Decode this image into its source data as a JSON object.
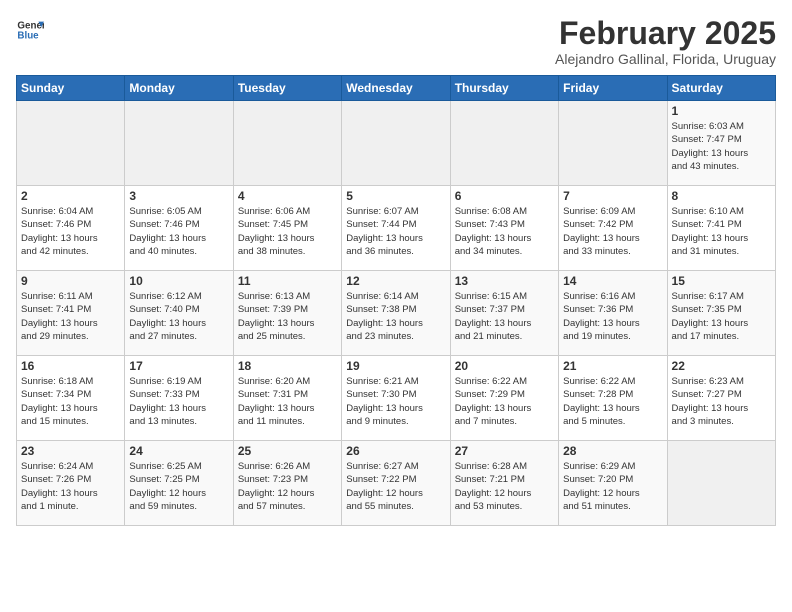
{
  "header": {
    "logo_general": "General",
    "logo_blue": "Blue",
    "title": "February 2025",
    "subtitle": "Alejandro Gallinal, Florida, Uruguay"
  },
  "days_of_week": [
    "Sunday",
    "Monday",
    "Tuesday",
    "Wednesday",
    "Thursday",
    "Friday",
    "Saturday"
  ],
  "weeks": [
    [
      {
        "day": "",
        "info": ""
      },
      {
        "day": "",
        "info": ""
      },
      {
        "day": "",
        "info": ""
      },
      {
        "day": "",
        "info": ""
      },
      {
        "day": "",
        "info": ""
      },
      {
        "day": "",
        "info": ""
      },
      {
        "day": "1",
        "info": "Sunrise: 6:03 AM\nSunset: 7:47 PM\nDaylight: 13 hours\nand 43 minutes."
      }
    ],
    [
      {
        "day": "2",
        "info": "Sunrise: 6:04 AM\nSunset: 7:46 PM\nDaylight: 13 hours\nand 42 minutes."
      },
      {
        "day": "3",
        "info": "Sunrise: 6:05 AM\nSunset: 7:46 PM\nDaylight: 13 hours\nand 40 minutes."
      },
      {
        "day": "4",
        "info": "Sunrise: 6:06 AM\nSunset: 7:45 PM\nDaylight: 13 hours\nand 38 minutes."
      },
      {
        "day": "5",
        "info": "Sunrise: 6:07 AM\nSunset: 7:44 PM\nDaylight: 13 hours\nand 36 minutes."
      },
      {
        "day": "6",
        "info": "Sunrise: 6:08 AM\nSunset: 7:43 PM\nDaylight: 13 hours\nand 34 minutes."
      },
      {
        "day": "7",
        "info": "Sunrise: 6:09 AM\nSunset: 7:42 PM\nDaylight: 13 hours\nand 33 minutes."
      },
      {
        "day": "8",
        "info": "Sunrise: 6:10 AM\nSunset: 7:41 PM\nDaylight: 13 hours\nand 31 minutes."
      }
    ],
    [
      {
        "day": "9",
        "info": "Sunrise: 6:11 AM\nSunset: 7:41 PM\nDaylight: 13 hours\nand 29 minutes."
      },
      {
        "day": "10",
        "info": "Sunrise: 6:12 AM\nSunset: 7:40 PM\nDaylight: 13 hours\nand 27 minutes."
      },
      {
        "day": "11",
        "info": "Sunrise: 6:13 AM\nSunset: 7:39 PM\nDaylight: 13 hours\nand 25 minutes."
      },
      {
        "day": "12",
        "info": "Sunrise: 6:14 AM\nSunset: 7:38 PM\nDaylight: 13 hours\nand 23 minutes."
      },
      {
        "day": "13",
        "info": "Sunrise: 6:15 AM\nSunset: 7:37 PM\nDaylight: 13 hours\nand 21 minutes."
      },
      {
        "day": "14",
        "info": "Sunrise: 6:16 AM\nSunset: 7:36 PM\nDaylight: 13 hours\nand 19 minutes."
      },
      {
        "day": "15",
        "info": "Sunrise: 6:17 AM\nSunset: 7:35 PM\nDaylight: 13 hours\nand 17 minutes."
      }
    ],
    [
      {
        "day": "16",
        "info": "Sunrise: 6:18 AM\nSunset: 7:34 PM\nDaylight: 13 hours\nand 15 minutes."
      },
      {
        "day": "17",
        "info": "Sunrise: 6:19 AM\nSunset: 7:33 PM\nDaylight: 13 hours\nand 13 minutes."
      },
      {
        "day": "18",
        "info": "Sunrise: 6:20 AM\nSunset: 7:31 PM\nDaylight: 13 hours\nand 11 minutes."
      },
      {
        "day": "19",
        "info": "Sunrise: 6:21 AM\nSunset: 7:30 PM\nDaylight: 13 hours\nand 9 minutes."
      },
      {
        "day": "20",
        "info": "Sunrise: 6:22 AM\nSunset: 7:29 PM\nDaylight: 13 hours\nand 7 minutes."
      },
      {
        "day": "21",
        "info": "Sunrise: 6:22 AM\nSunset: 7:28 PM\nDaylight: 13 hours\nand 5 minutes."
      },
      {
        "day": "22",
        "info": "Sunrise: 6:23 AM\nSunset: 7:27 PM\nDaylight: 13 hours\nand 3 minutes."
      }
    ],
    [
      {
        "day": "23",
        "info": "Sunrise: 6:24 AM\nSunset: 7:26 PM\nDaylight: 13 hours\nand 1 minute."
      },
      {
        "day": "24",
        "info": "Sunrise: 6:25 AM\nSunset: 7:25 PM\nDaylight: 12 hours\nand 59 minutes."
      },
      {
        "day": "25",
        "info": "Sunrise: 6:26 AM\nSunset: 7:23 PM\nDaylight: 12 hours\nand 57 minutes."
      },
      {
        "day": "26",
        "info": "Sunrise: 6:27 AM\nSunset: 7:22 PM\nDaylight: 12 hours\nand 55 minutes."
      },
      {
        "day": "27",
        "info": "Sunrise: 6:28 AM\nSunset: 7:21 PM\nDaylight: 12 hours\nand 53 minutes."
      },
      {
        "day": "28",
        "info": "Sunrise: 6:29 AM\nSunset: 7:20 PM\nDaylight: 12 hours\nand 51 minutes."
      },
      {
        "day": "",
        "info": ""
      }
    ]
  ]
}
